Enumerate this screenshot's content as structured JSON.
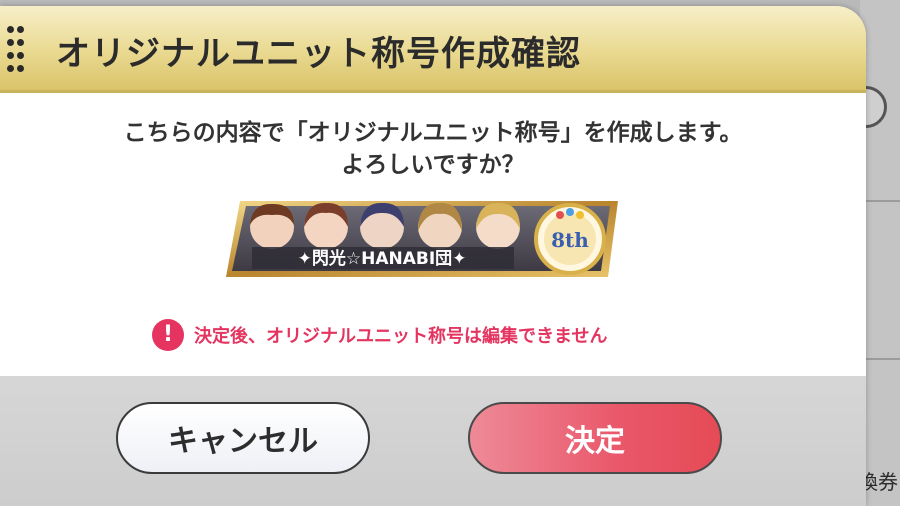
{
  "dialog": {
    "title": "オリジナルユニット称号作成確認",
    "message_line1": "こちらの内容で「オリジナルユニット称号」を作成します。",
    "message_line2": "よろしいですか？",
    "title_banner": {
      "name": "✦閃光☆HANABI団✦",
      "badge_text": "8th"
    },
    "warning": {
      "icon": "exclamation-icon",
      "text": "決定後、オリジナルユニット称号は編集できません"
    },
    "buttons": {
      "cancel_label": "キャンセル",
      "confirm_label": "決定"
    }
  },
  "background": {
    "partial_text": "換券"
  },
  "colors": {
    "header_gold": "#e9d990",
    "warning_red": "#e4345f",
    "confirm_red": "#e9576a"
  }
}
